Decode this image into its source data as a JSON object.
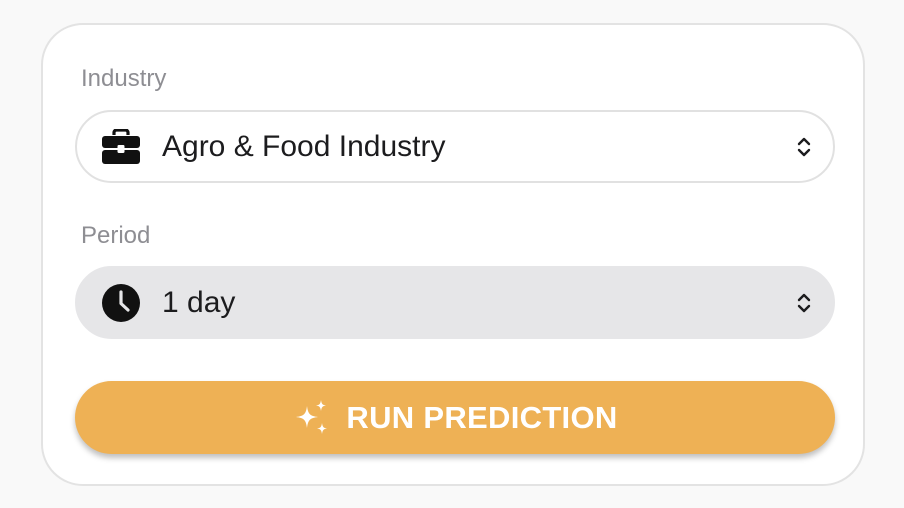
{
  "form": {
    "industry": {
      "label": "Industry",
      "value": "Agro & Food Industry",
      "icon": "briefcase-icon"
    },
    "period": {
      "label": "Period",
      "value": "1 day",
      "icon": "clock-icon"
    },
    "run_button": {
      "label": "RUN PREDICTION",
      "icon": "sparkles-icon"
    }
  },
  "colors": {
    "accent": "#eeb155",
    "card_border": "#e3e3e3",
    "select_grey": "#e6e6e8",
    "label_grey": "#8e8e93"
  }
}
